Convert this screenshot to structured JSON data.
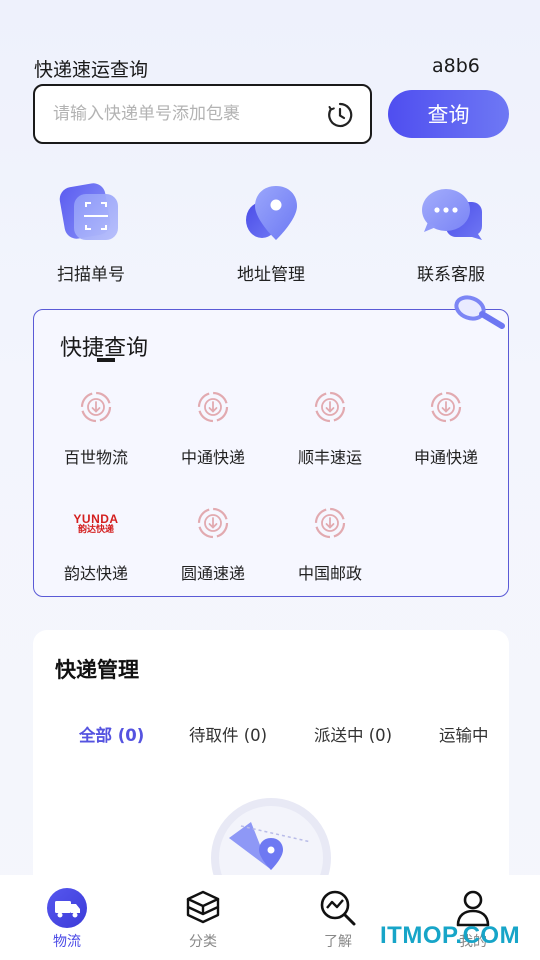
{
  "header": {
    "title": "快递速运查询",
    "code": "a8b6",
    "search_placeholder": "请输入快递单号添加包裹",
    "query_label": "查询"
  },
  "quick_actions": [
    {
      "label": "扫描单号",
      "icon": "scan-icon"
    },
    {
      "label": "地址管理",
      "icon": "location-pin-icon"
    },
    {
      "label": "联系客服",
      "icon": "chat-icon"
    }
  ],
  "quick_query": {
    "title": "快捷查询",
    "carriers": [
      {
        "label": "百世物流",
        "icon": "download-circle-icon"
      },
      {
        "label": "中通快递",
        "icon": "download-circle-icon"
      },
      {
        "label": "顺丰速运",
        "icon": "download-circle-icon"
      },
      {
        "label": "申通快递",
        "icon": "download-circle-icon"
      },
      {
        "label": "韵达快递",
        "icon": "yunda-logo",
        "logo_text": "YUNDA",
        "logo_sub": "韵达快递"
      },
      {
        "label": "圆通速递",
        "icon": "download-circle-icon"
      },
      {
        "label": "中国邮政",
        "icon": "download-circle-icon"
      }
    ]
  },
  "management": {
    "title": "快递管理",
    "tabs": [
      "全部 (0)",
      "待取件 (0)",
      "派送中 (0)",
      "运输中"
    ],
    "active_tab": 0
  },
  "nav": {
    "items": [
      {
        "label": "物流",
        "icon": "truck-icon"
      },
      {
        "label": "分类",
        "icon": "cube-icon"
      },
      {
        "label": "了解",
        "icon": "search-chart-icon"
      },
      {
        "label": "我的",
        "icon": "user-icon"
      }
    ],
    "active": 0
  },
  "watermark": "ITMOP.COM",
  "colors": {
    "accent": "#5553e0",
    "button_start": "#4f4ef0",
    "button_end": "#6e78f4",
    "carrier_icon": "#e0a8ab"
  }
}
